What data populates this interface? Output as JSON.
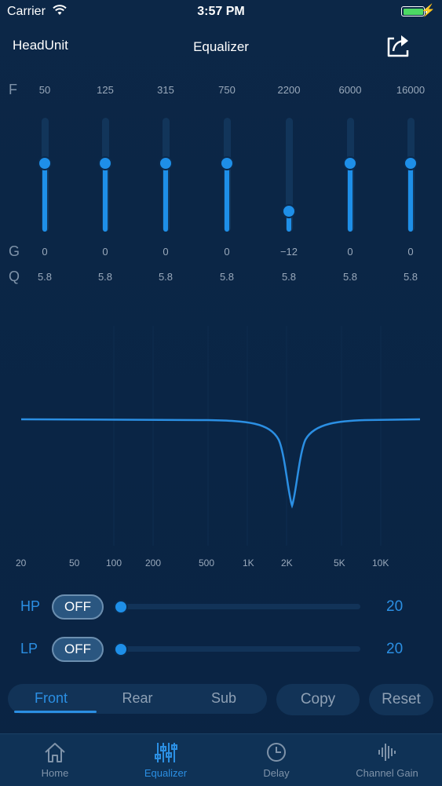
{
  "status": {
    "carrier": "Carrier",
    "time": "3:57 PM",
    "bolt": "⚡"
  },
  "header": {
    "left": "HeadUnit",
    "title": "Equalizer"
  },
  "labels": {
    "f": "F",
    "g": "G",
    "q": "Q"
  },
  "bands": [
    {
      "freq": "50",
      "gain": "0",
      "gain_db": 0,
      "q": "5.8"
    },
    {
      "freq": "125",
      "gain": "0",
      "gain_db": 0,
      "q": "5.8"
    },
    {
      "freq": "315",
      "gain": "0",
      "gain_db": 0,
      "q": "5.8"
    },
    {
      "freq": "750",
      "gain": "0",
      "gain_db": 0,
      "q": "5.8"
    },
    {
      "freq": "2200",
      "gain": "−12",
      "gain_db": -12,
      "q": "5.8"
    },
    {
      "freq": "6000",
      "gain": "0",
      "gain_db": 0,
      "q": "5.8"
    },
    {
      "freq": "16000",
      "gain": "0",
      "gain_db": 0,
      "q": "5.8"
    }
  ],
  "curve_ticks": [
    "20",
    "50",
    "100",
    "200",
    "500",
    "1K",
    "2K",
    "5K",
    "10K"
  ],
  "filters": {
    "hp": {
      "label": "HP",
      "toggle": "OFF",
      "value": "20"
    },
    "lp": {
      "label": "LP",
      "toggle": "OFF",
      "value": "20"
    }
  },
  "segments": {
    "front": "Front",
    "rear": "Rear",
    "sub": "Sub"
  },
  "actions": {
    "copy": "Copy",
    "reset": "Reset"
  },
  "tabs": {
    "home": "Home",
    "equalizer": "Equalizer",
    "delay": "Delay",
    "channel_gain": "Channel Gain"
  },
  "colors": {
    "accent": "#2b8fe3",
    "background": "#0b2646",
    "battery": "#4cd964"
  }
}
